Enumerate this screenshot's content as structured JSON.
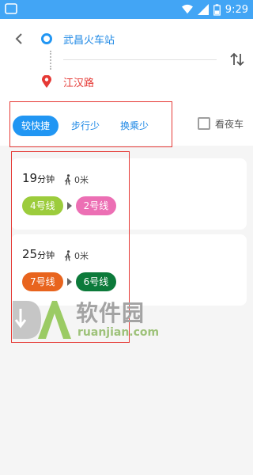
{
  "status_bar": {
    "time": "9:29"
  },
  "route": {
    "from": "武昌火车站",
    "to": "江汉路"
  },
  "tabs": [
    {
      "label": "较快捷",
      "active": true
    },
    {
      "label": "步行少",
      "active": false
    },
    {
      "label": "换乘少",
      "active": false
    }
  ],
  "night_bus": {
    "label": "看夜车",
    "checked": false
  },
  "results": [
    {
      "duration": "19",
      "duration_unit": "分钟",
      "walk": "0米",
      "lines": [
        {
          "name": "4号线",
          "color": "#9ccc3c"
        },
        {
          "name": "2号线",
          "color": "#ec6fb4"
        }
      ]
    },
    {
      "duration": "25",
      "duration_unit": "分钟",
      "walk": "0米",
      "lines": [
        {
          "name": "7号线",
          "color": "#e8641e"
        },
        {
          "name": "6号线",
          "color": "#0c7a3a"
        }
      ]
    }
  ],
  "watermark": {
    "brand": "软件园",
    "url": "ruanjian.com"
  },
  "colors": {
    "accent": "#2196f3",
    "from_text": "#1e88e5",
    "to_text": "#e53935",
    "highlight_box": "#e53935"
  }
}
